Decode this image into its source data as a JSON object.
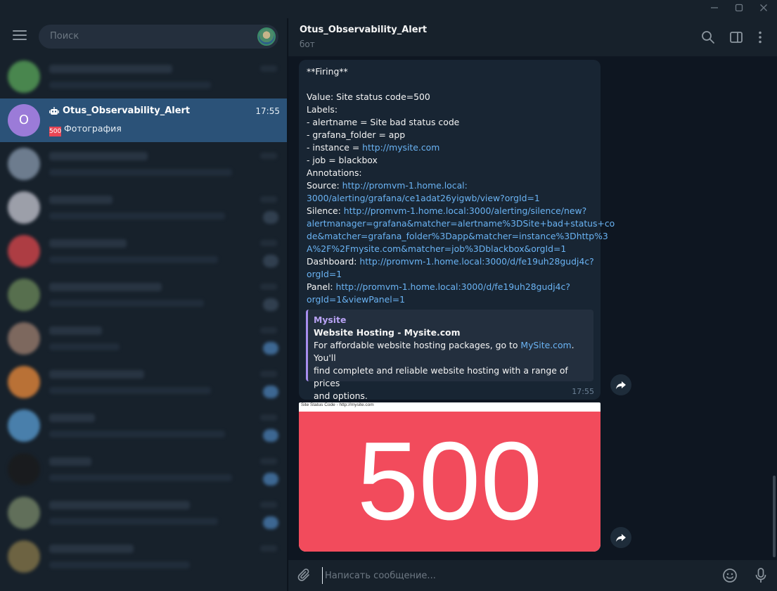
{
  "search": {
    "placeholder": "Поиск"
  },
  "active_chat": {
    "avatar_letter": "O",
    "name": "Otus_Observability_Alert",
    "time": "17:55",
    "preview": "Фотография",
    "thumb_text": "500"
  },
  "header": {
    "title": "Otus_Observability_Alert",
    "status": "бот"
  },
  "message": {
    "lines": [
      {
        "text": "**Firing**"
      },
      {
        "blank": true
      },
      {
        "text": "Value: Site status code=500"
      },
      {
        "text": "Labels:"
      },
      {
        "text": " - alertname = Site bad status code"
      },
      {
        "text": " - grafana_folder = app"
      },
      {
        "text": " - instance = ",
        "link": "http://mysite.com"
      },
      {
        "text": " - job = blackbox"
      },
      {
        "text": "Annotations:"
      },
      {
        "text": "Source: ",
        "link": "http://promvm-1.home.local:"
      },
      {
        "link": "3000/alerting/grafana/ce1adat26yigwb/view?orgId=1"
      },
      {
        "text": "Silence: ",
        "link": "http://promvm-1.home.local:3000/alerting/silence/new?"
      },
      {
        "link": "alertmanager=grafana&matcher=alertname%3DSite+bad+status+co"
      },
      {
        "link": "de&matcher=grafana_folder%3Dapp&matcher=instance%3Dhttp%3"
      },
      {
        "link": "A%2F%2Fmysite.com&matcher=job%3Dblackbox&orgId=1"
      },
      {
        "text": "Dashboard: ",
        "link": "http://promvm-1.home.local:3000/d/fe19uh28gudj4c?"
      },
      {
        "link": "orgId=1"
      },
      {
        "text": "Panel: ",
        "link": "http://promvm-1.home.local:3000/d/fe19uh28gudj4c?"
      },
      {
        "link": "orgId=1&viewPanel=1"
      }
    ],
    "preview": {
      "site": "Mysite",
      "title": "Website Hosting - Mysite.com",
      "desc_before": "For affordable website hosting packages, go to ",
      "desc_link": "MySite.com",
      "desc_after_1": ". You'll",
      "desc_line2": "find complete and reliable website hosting with a range of prices",
      "desc_line3": "and options."
    },
    "time": "17:55"
  },
  "photo": {
    "caption": "Site Status Code - http://mysite.com",
    "code": "500",
    "background_color": "#f24b5c"
  },
  "composer": {
    "placeholder": "Написать сообщение..."
  },
  "colors": {
    "accent": "#2b5278",
    "link": "#6ab3f3",
    "bubble": "#182533",
    "background": "#0e1621"
  }
}
